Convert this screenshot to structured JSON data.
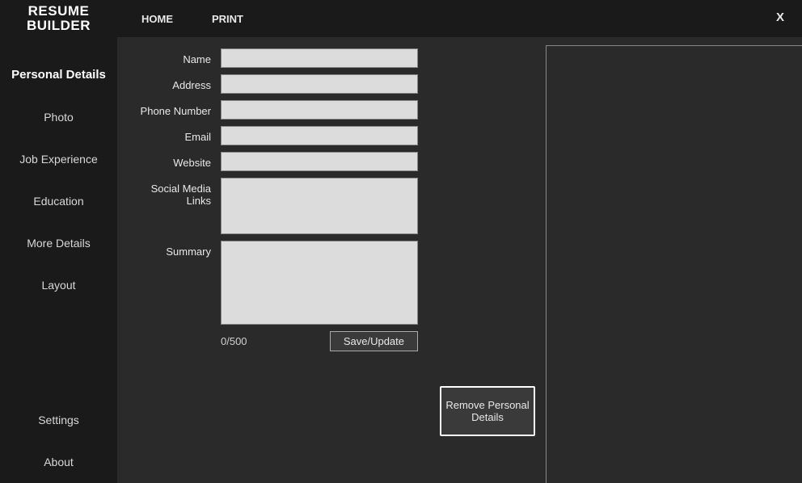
{
  "app": {
    "title_line1": "RESUME",
    "title_line2": "BUILDER",
    "close": "X"
  },
  "nav": {
    "home": "HOME",
    "print": "PRINT"
  },
  "sidebar": {
    "items": [
      {
        "label": "Personal Details"
      },
      {
        "label": "Photo"
      },
      {
        "label": "Job Experience"
      },
      {
        "label": "Education"
      },
      {
        "label": "More Details"
      },
      {
        "label": "Layout"
      }
    ],
    "settings": "Settings",
    "about": "About"
  },
  "form": {
    "name_label": "Name",
    "name_value": "",
    "address_label": "Address",
    "address_value": "",
    "phone_label": "Phone Number",
    "phone_value": "",
    "email_label": "Email",
    "email_value": "",
    "website_label": "Website",
    "website_value": "",
    "social_label": "Social Media Links",
    "social_value": "",
    "summary_label": "Summary",
    "summary_value": "",
    "counter": "0/500",
    "save_label": "Save/Update",
    "remove_label": "Remove Personal Details"
  }
}
